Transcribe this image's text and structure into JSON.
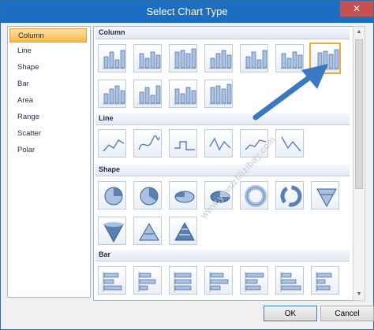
{
  "window": {
    "title": "Select Chart Type",
    "close_glyph": "✕"
  },
  "left_list": {
    "items": [
      {
        "label": "Column",
        "selected": true
      },
      {
        "label": "Line"
      },
      {
        "label": "Shape"
      },
      {
        "label": "Bar"
      },
      {
        "label": "Area"
      },
      {
        "label": "Range"
      },
      {
        "label": "Scatter"
      },
      {
        "label": "Polar"
      }
    ]
  },
  "sections": [
    {
      "label": "Column",
      "icon_count": 11,
      "selected_index": 6
    },
    {
      "label": "Line",
      "icon_count": 6
    },
    {
      "label": "Shape",
      "icon_count": 10
    },
    {
      "label": "Bar",
      "icon_count": 7
    }
  ],
  "buttons": {
    "ok": "OK",
    "cancel": "Cancel"
  },
  "watermark": "www.yavuzfilizibay.com",
  "colors": {
    "accent": "#1b6ec1",
    "selection": "#f2a73b",
    "arrow": "#3a78c2"
  }
}
